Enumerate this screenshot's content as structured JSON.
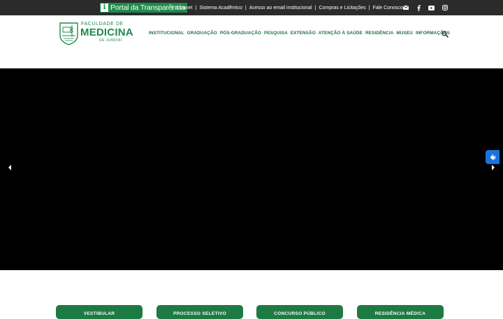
{
  "colors": {
    "brand_green": "#1e8a4a",
    "nav_green": "#1e7040",
    "topbar": "#2b2b2b",
    "hero": "#000000",
    "accessibility_blue": "#1a73d9"
  },
  "topbar": {
    "transparency_portal": "Portal da Transparência",
    "links": [
      "Intranet",
      "Sistema Acadêmico",
      "Acesso ao email institucional",
      "Compras e Licitações",
      "Fale Conosco"
    ],
    "social_icons": [
      "envelope-icon",
      "facebook-icon",
      "youtube-icon",
      "instagram-icon"
    ]
  },
  "logo": {
    "line1": "FACULDADE DE",
    "line2": "MEDICINA",
    "line3": "DE JUNDIAÍ"
  },
  "nav": {
    "items": [
      "INSTITUCIONAL",
      "GRADUAÇÃO",
      "PÓS-GRADUAÇÃO",
      "PESQUISA",
      "EXTENSÃO",
      "ATENÇÃO À SAÚDE",
      "RESIDÊNCIA",
      "MUSEU",
      "INFORMAÇÕES"
    ],
    "search_icon": "search-icon"
  },
  "carousel": {
    "prev_icon": "arrow-left-icon",
    "next_icon": "arrow-right-icon"
  },
  "accessibility": {
    "icon": "sign-language-icon"
  },
  "quick_access": [
    "VESTIBULAR",
    "PROCESSO SELETIVO",
    "CONCURSO PÚBLICO",
    "RESIDÊNCIA MÉDICA"
  ]
}
